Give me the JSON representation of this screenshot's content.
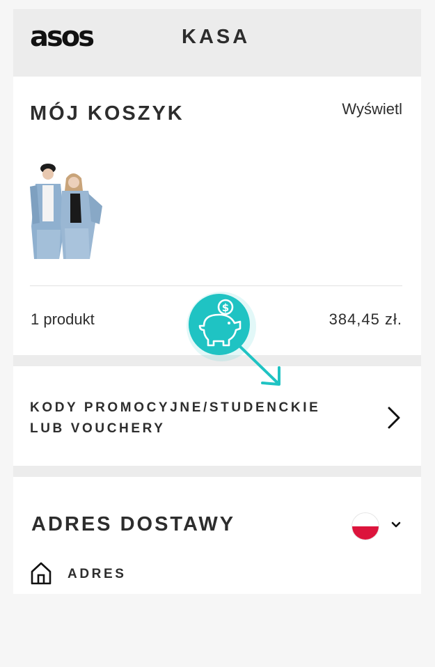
{
  "header": {
    "logo": "asos",
    "title": "KASA"
  },
  "cart": {
    "title": "MÓJ KOSZYK",
    "view_link": "Wyświetl",
    "count": "1 produkt",
    "total": "384,45 zł."
  },
  "promo": {
    "line1": "KODY PROMOCYJNE/STUDENCKIE",
    "line2": "LUB VOUCHERY"
  },
  "delivery": {
    "title": "ADRES DOSTAWY",
    "country_flag": "poland-flag",
    "address_label": "ADRES"
  },
  "colors": {
    "accent": "#1fc3c3",
    "text": "#2d2d2d",
    "header_bg": "#ececec"
  }
}
